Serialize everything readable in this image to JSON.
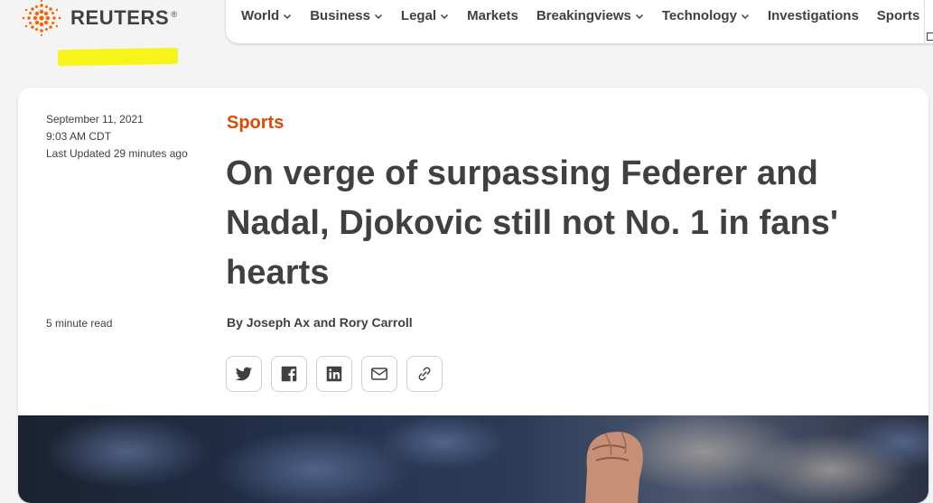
{
  "brand": {
    "name": "REUTERS",
    "reg_mark": "®",
    "accent_color": "#dc4b04"
  },
  "nav": {
    "items": [
      {
        "label": "World",
        "has_dropdown": true
      },
      {
        "label": "Business",
        "has_dropdown": true
      },
      {
        "label": "Legal",
        "has_dropdown": true
      },
      {
        "label": "Markets",
        "has_dropdown": false
      },
      {
        "label": "Breakingviews",
        "has_dropdown": true
      },
      {
        "label": "Technology",
        "has_dropdown": true
      },
      {
        "label": "Investigations",
        "has_dropdown": false
      },
      {
        "label": "Sports",
        "has_dropdown": true
      }
    ]
  },
  "article": {
    "date": "September 11, 2021",
    "time": "9:03 AM CDT",
    "updated": "Last Updated 29 minutes ago",
    "read_time": "5 minute read",
    "section": "Sports",
    "headline": "On verge of surpassing Federer and Nadal, Djokovic still not No. 1 in fans' hearts",
    "byline": "By Joseph Ax and Rory Carroll"
  },
  "share": {
    "buttons": [
      {
        "icon": "twitter-icon"
      },
      {
        "icon": "facebook-icon"
      },
      {
        "icon": "linkedin-icon"
      },
      {
        "icon": "email-icon"
      },
      {
        "icon": "link-icon"
      }
    ]
  },
  "highlight_color": "#f6f41a"
}
